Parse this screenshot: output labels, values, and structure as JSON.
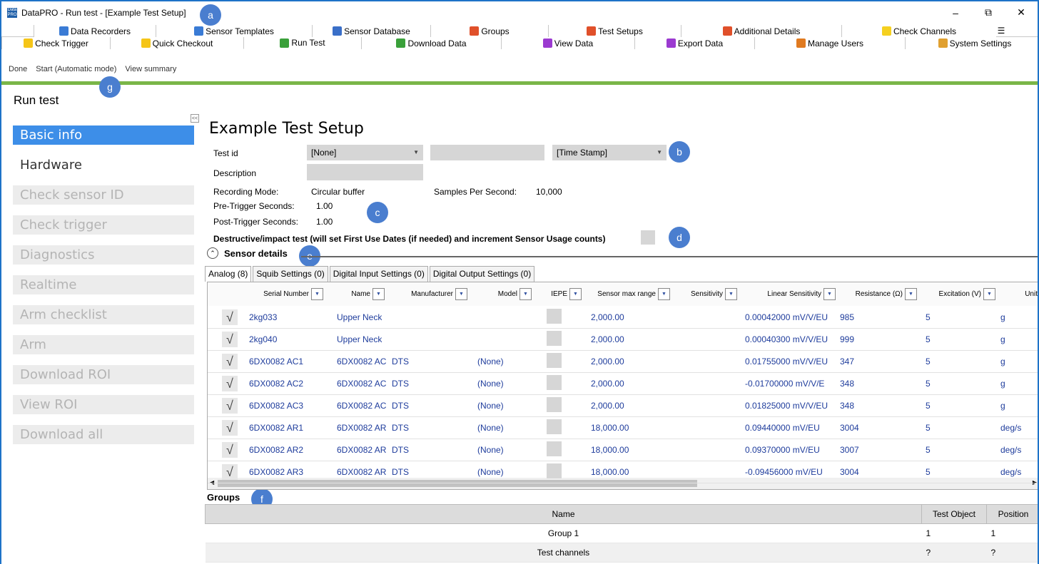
{
  "window": {
    "title": "DataPRO - Run test - [Example Test Setup]",
    "app_icon_text": "Data PRO",
    "controls": [
      "–",
      "⧉",
      "✕"
    ]
  },
  "tabs_row1": [
    {
      "label": "Data Recorders",
      "icon": "data-recorders-icon",
      "color": "#3a7bd5"
    },
    {
      "label": "Sensor Templates",
      "icon": "sensor-templates-icon",
      "color": "#3a7bd5"
    },
    {
      "label": "Sensor Database",
      "icon": "sensor-database-icon",
      "color": "#3a6fc8"
    },
    {
      "label": "Groups",
      "icon": "groups-icon",
      "color": "#e0502a"
    },
    {
      "label": "Test Setups",
      "icon": "test-setups-icon",
      "color": "#e0502a"
    },
    {
      "label": "Additional Details",
      "icon": "additional-details-icon",
      "color": "#e0502a"
    },
    {
      "label": "Check Channels",
      "icon": "check-channels-icon",
      "color": "#f5d020"
    }
  ],
  "tabs_row2": [
    {
      "label": "Check Trigger",
      "icon": "check-trigger-icon",
      "color": "#f5c518"
    },
    {
      "label": "Quick Checkout",
      "icon": "quick-checkout-icon",
      "color": "#f5c518"
    },
    {
      "label": "Run Test",
      "icon": "run-test-icon",
      "color": "#3aa03a"
    },
    {
      "label": "Download Data",
      "icon": "download-data-icon",
      "color": "#3aa03a"
    },
    {
      "label": "View Data",
      "icon": "view-data-icon",
      "color": "#9b3ad0"
    },
    {
      "label": "Export Data",
      "icon": "export-data-icon",
      "color": "#9b3ad0"
    },
    {
      "label": "Manage Users",
      "icon": "manage-users-icon",
      "color": "#e07a20"
    },
    {
      "label": "System Settings",
      "icon": "system-settings-icon",
      "color": "#e0a030"
    }
  ],
  "toolbar": {
    "done": "Done",
    "start": "Start (Automatic mode)",
    "summary": "View summary"
  },
  "page_title": "Run test",
  "nav": [
    "Basic info",
    "Hardware",
    "Check sensor ID",
    "Check trigger",
    "Diagnostics",
    "Realtime",
    "Arm checklist",
    "Arm",
    "Download ROI",
    "View ROI",
    "Download all"
  ],
  "test": {
    "name": "Example Test Setup",
    "test_id_label": "Test id",
    "test_id_value": "[None]",
    "timestamp_value": "[Time Stamp]",
    "description_label": "Description",
    "recording_mode_label": "Recording Mode:",
    "recording_mode_value": "Circular buffer",
    "sps_label": "Samples Per Second:",
    "sps_value": "10,000",
    "pre_label": "Pre-Trigger Seconds:",
    "pre_value": "1.00",
    "post_label": "Post-Trigger Seconds:",
    "post_value": "1.00",
    "destructive_label": "Destructive/impact test (will set First Use Dates (if needed) and increment Sensor Usage counts)"
  },
  "callouts": [
    "a",
    "b",
    "c",
    "d",
    "e",
    "f",
    "g"
  ],
  "sensor_details": {
    "title": "Sensor details",
    "subtabs": [
      "Analog (8)",
      "Squib Settings (0)",
      "Digital Input Settings (0)",
      "Digital Output Settings (0)"
    ],
    "columns": [
      "Serial Number",
      "Name",
      "Manufacturer",
      "Model",
      "IEPE",
      "Sensor max range",
      "Sensitivity",
      "Linear Sensitivity",
      "Resistance (Ω)",
      "Excitation (V)",
      "Units"
    ],
    "rows": [
      {
        "serial": "2kg033",
        "name": "Upper Neck",
        "mfr": "",
        "model": "",
        "range": "2,000.00",
        "lin": "0.00042000 mV/V/EU",
        "res": "985",
        "exc": "5",
        "units": "g"
      },
      {
        "serial": "2kg040",
        "name": "Upper Neck",
        "mfr": "",
        "model": "",
        "range": "2,000.00",
        "lin": "0.00040300 mV/V/EU",
        "res": "999",
        "exc": "5",
        "units": "g"
      },
      {
        "serial": "6DX0082 AC1",
        "name": "6DX0082 AC",
        "mfr": "DTS",
        "model": "(None)",
        "range": "2,000.00",
        "lin": "0.01755000 mV/V/EU",
        "res": "347",
        "exc": "5",
        "units": "g"
      },
      {
        "serial": "6DX0082 AC2",
        "name": "6DX0082 AC",
        "mfr": "DTS",
        "model": "(None)",
        "range": "2,000.00",
        "lin": "-0.01700000 mV/V/E",
        "res": "348",
        "exc": "5",
        "units": "g"
      },
      {
        "serial": "6DX0082 AC3",
        "name": "6DX0082 AC",
        "mfr": "DTS",
        "model": "(None)",
        "range": "2,000.00",
        "lin": "0.01825000 mV/V/EU",
        "res": "348",
        "exc": "5",
        "units": "g"
      },
      {
        "serial": "6DX0082 AR1",
        "name": "6DX0082 AR",
        "mfr": "DTS",
        "model": "(None)",
        "range": "18,000.00",
        "lin": "0.09440000 mV/EU",
        "res": "3004",
        "exc": "5",
        "units": "deg/s"
      },
      {
        "serial": "6DX0082 AR2",
        "name": "6DX0082 AR",
        "mfr": "DTS",
        "model": "(None)",
        "range": "18,000.00",
        "lin": "0.09370000 mV/EU",
        "res": "3007",
        "exc": "5",
        "units": "deg/s"
      },
      {
        "serial": "6DX0082 AR3",
        "name": "6DX0082 AR",
        "mfr": "DTS",
        "model": "(None)",
        "range": "18,000.00",
        "lin": "-0.09456000 mV/EU",
        "res": "3004",
        "exc": "5",
        "units": "deg/s"
      }
    ],
    "check_glyph": "√"
  },
  "groups": {
    "title": "Groups",
    "columns": [
      "Name",
      "Test Object",
      "Position"
    ],
    "rows": [
      {
        "name": "Group 1",
        "obj": "1",
        "pos": "1"
      },
      {
        "name": "Test channels",
        "obj": "?",
        "pos": "?"
      }
    ]
  }
}
